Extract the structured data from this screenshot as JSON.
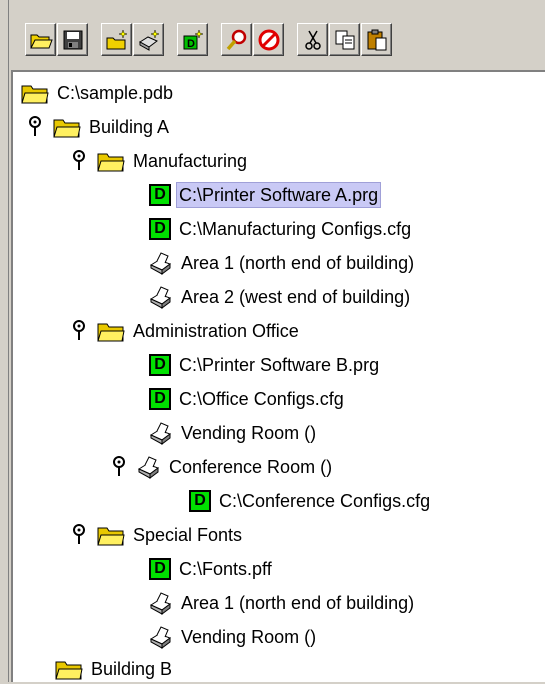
{
  "toolbar": {
    "buttons": [
      {
        "name": "open-folder-icon"
      },
      {
        "name": "save-icon"
      },
      {
        "name": "new-building-icon"
      },
      {
        "name": "new-area-icon"
      },
      {
        "name": "new-device-icon"
      },
      {
        "name": "find-icon"
      },
      {
        "name": "stop-icon"
      },
      {
        "name": "cut-icon"
      },
      {
        "name": "copy-icon"
      },
      {
        "name": "paste-icon"
      }
    ]
  },
  "tree": {
    "root": "C:\\sample.pdb",
    "nodes": [
      {
        "label": "Building A"
      },
      {
        "label": "Manufacturing"
      },
      {
        "label": "C:\\Printer Software A.prg"
      },
      {
        "label": "C:\\Manufacturing Configs.cfg"
      },
      {
        "label": "Area 1 (north end of building)"
      },
      {
        "label": "Area 2 (west end of building)"
      },
      {
        "label": "Administration Office"
      },
      {
        "label": "C:\\Printer Software B.prg"
      },
      {
        "label": "C:\\Office Configs.cfg"
      },
      {
        "label": "Vending Room ()"
      },
      {
        "label": "Conference Room ()"
      },
      {
        "label": "C:\\Conference Configs.cfg"
      },
      {
        "label": "Special Fonts"
      },
      {
        "label": "C:\\Fonts.pff"
      },
      {
        "label": "Area 1 (north end of building)"
      },
      {
        "label": "Vending Room ()"
      },
      {
        "label": "Building B"
      }
    ],
    "selected_label": "C:\\Printer Software A.prg",
    "download_badge": "D"
  }
}
